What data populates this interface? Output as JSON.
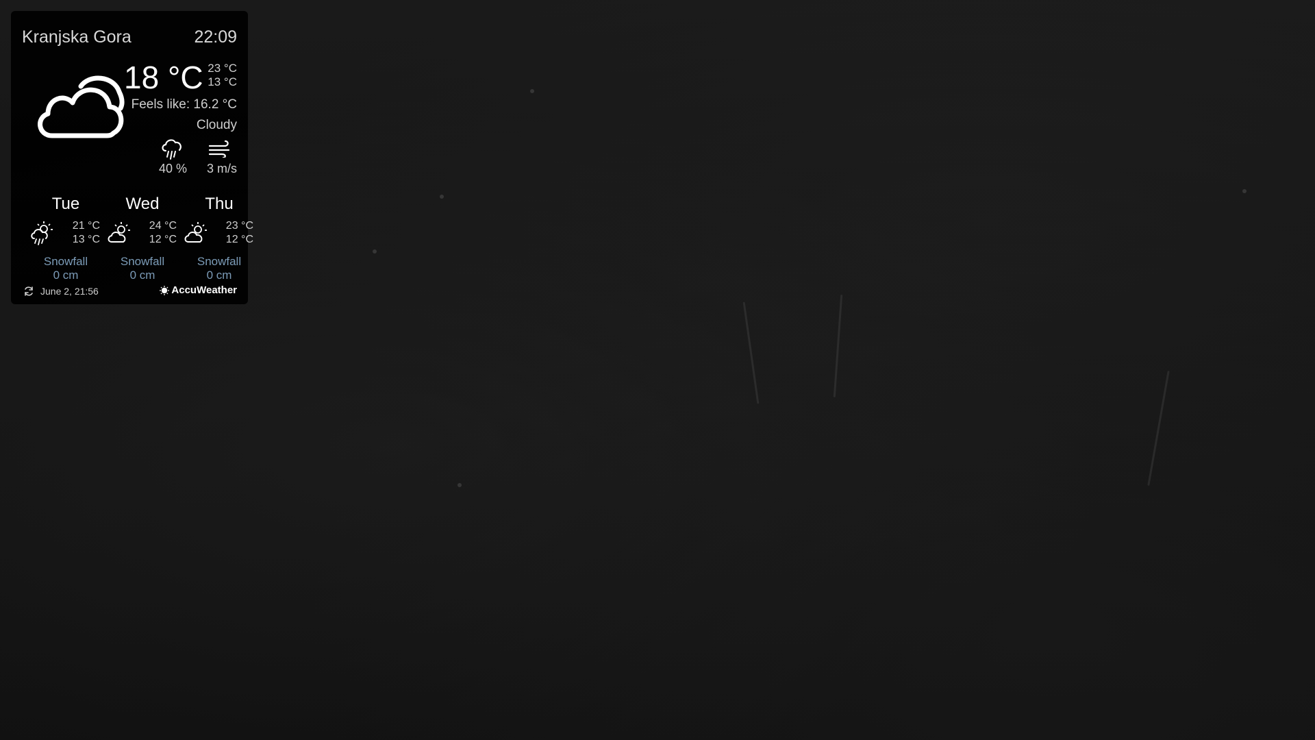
{
  "widget": {
    "location": "Kranjska Gora",
    "time": "22:09",
    "current": {
      "temperature": "18 °C",
      "high": "23 °C",
      "low": "13 °C",
      "feels_like": "Feels like: 16.2 °C",
      "condition": "Cloudy",
      "icon": "cloud-icon",
      "precipitation": "40 %",
      "precipitation_icon": "rain-cloud-icon",
      "wind": "3 m/s",
      "wind_icon": "wind-icon"
    },
    "forecast": [
      {
        "day": "Tue",
        "high": "21 °C",
        "low": "13 °C",
        "icon": "sun-rain-cloud-icon",
        "snow_label": "Snowfall",
        "snow_value": "0 cm"
      },
      {
        "day": "Wed",
        "high": "24 °C",
        "low": "12 °C",
        "icon": "partly-cloudy-icon",
        "snow_label": "Snowfall",
        "snow_value": "0 cm"
      },
      {
        "day": "Thu",
        "high": "23 °C",
        "low": "12 °C",
        "icon": "partly-cloudy-icon",
        "snow_label": "Snowfall",
        "snow_value": "0 cm"
      }
    ],
    "updated": "June  2, 21:56",
    "provider": "AccuWeather",
    "colors": {
      "accent_snow": "#7c9cb8",
      "panel_background": "#000000",
      "text": "#cfcfcf"
    }
  }
}
